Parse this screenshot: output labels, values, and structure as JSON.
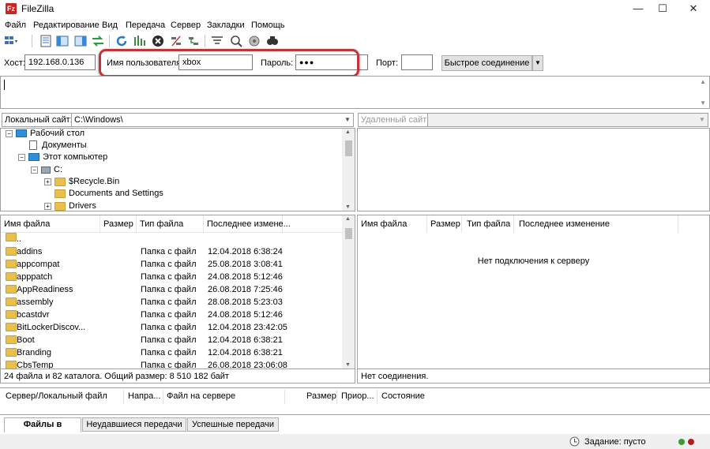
{
  "window": {
    "app_icon_glyph": "Fz",
    "title": "FileZilla",
    "controls": {
      "minimize": "—",
      "maximize": "☐",
      "close": "✕"
    }
  },
  "menu": [
    "Файл",
    "Редактирование",
    "Вид",
    "Передача",
    "Сервер",
    "Закладки",
    "Помощь"
  ],
  "toolbar_icons": [
    "site-manager-icon",
    "toggle-message-log-icon",
    "toggle-local-tree-icon",
    "toggle-remote-tree-icon",
    "toggle-queue-icon",
    "refresh-icon",
    "process-queue-icon",
    "cancel-icon",
    "disconnect-icon",
    "reconnect-icon",
    "directory-listing-filter-icon",
    "compare-directories-icon",
    "synchronized-browsing-icon",
    "search-icon"
  ],
  "quickconnect": {
    "host_label": "Хост:",
    "host_value": "192.168.0.136",
    "user_label": "Имя пользователя",
    "user_value": "xbox",
    "pass_label": "Пароль:",
    "pass_value": "●●●",
    "port_label": "Порт:",
    "port_value": "",
    "connect_label": "Быстрое соединение",
    "dropdown_glyph": "▼",
    "highlight_color": "#c0343a"
  },
  "local_site": {
    "label": "Локальный сайт:",
    "path": "C:\\Windows\\"
  },
  "remote_site": {
    "label": "Удаленный сайт:",
    "path": ""
  },
  "local_tree": [
    {
      "label": "Рабочий стол",
      "icon": "desktop-icon",
      "expander": "−"
    },
    {
      "label": "Документы",
      "icon": "documents-icon",
      "expander": ""
    },
    {
      "label": "Этот компьютер",
      "icon": "computer-icon",
      "expander": "−"
    },
    {
      "label": "C:",
      "icon": "drive-icon",
      "expander": "−"
    },
    {
      "label": "$Recycle.Bin",
      "icon": "folder-icon",
      "expander": "+"
    },
    {
      "label": "Documents and Settings",
      "icon": "folder-icon",
      "expander": ""
    },
    {
      "label": "Drivers",
      "icon": "folder-icon",
      "expander": "+"
    }
  ],
  "local_columns": [
    "Имя файла",
    "Размер",
    "Тип файла",
    "Последнее измене..."
  ],
  "local_files": [
    {
      "name": "..",
      "size": "",
      "type": "",
      "modified": ""
    },
    {
      "name": "addins",
      "size": "",
      "type": "Папка с файл",
      "modified": "12.04.2018 6:38:24"
    },
    {
      "name": "appcompat",
      "size": "",
      "type": "Папка с файл",
      "modified": "25.08.2018 3:08:41"
    },
    {
      "name": "apppatch",
      "size": "",
      "type": "Папка с файл",
      "modified": "24.08.2018 5:12:46"
    },
    {
      "name": "AppReadiness",
      "size": "",
      "type": "Папка с файл",
      "modified": "26.08.2018 7:25:46"
    },
    {
      "name": "assembly",
      "size": "",
      "type": "Папка с файл",
      "modified": "28.08.2018 5:23:03"
    },
    {
      "name": "bcastdvr",
      "size": "",
      "type": "Папка с файл",
      "modified": "24.08.2018 5:12:46"
    },
    {
      "name": "BitLockerDiscov...",
      "size": "",
      "type": "Папка с файл",
      "modified": "12.04.2018 23:42:05"
    },
    {
      "name": "Boot",
      "size": "",
      "type": "Папка с файл",
      "modified": "12.04.2018 6:38:21"
    },
    {
      "name": "Branding",
      "size": "",
      "type": "Папка с файл",
      "modified": "12.04.2018 6:38:21"
    },
    {
      "name": "CbsTemp",
      "size": "",
      "type": "Папка с файл",
      "modified": "26.08.2018 23:06:08"
    }
  ],
  "local_status": "24 файла и 82 каталога. Общий размер: 8 510 182 байт",
  "remote_columns": [
    "Имя файла",
    "Размер",
    "Тип файла",
    "Последнее изменение"
  ],
  "remote_empty": "Нет подключения к серверу",
  "remote_status": "Нет соединения.",
  "queue_columns": [
    "Сервер/Локальный файл",
    "Напра...",
    "Файл на сервере",
    "Размер",
    "Приор...",
    "Состояние"
  ],
  "queue_tabs": [
    "Файлы в задании",
    "Неудавшиеся передачи",
    "Успешные передачи"
  ],
  "statusbar": {
    "queue_text": "Задание: пусто"
  }
}
